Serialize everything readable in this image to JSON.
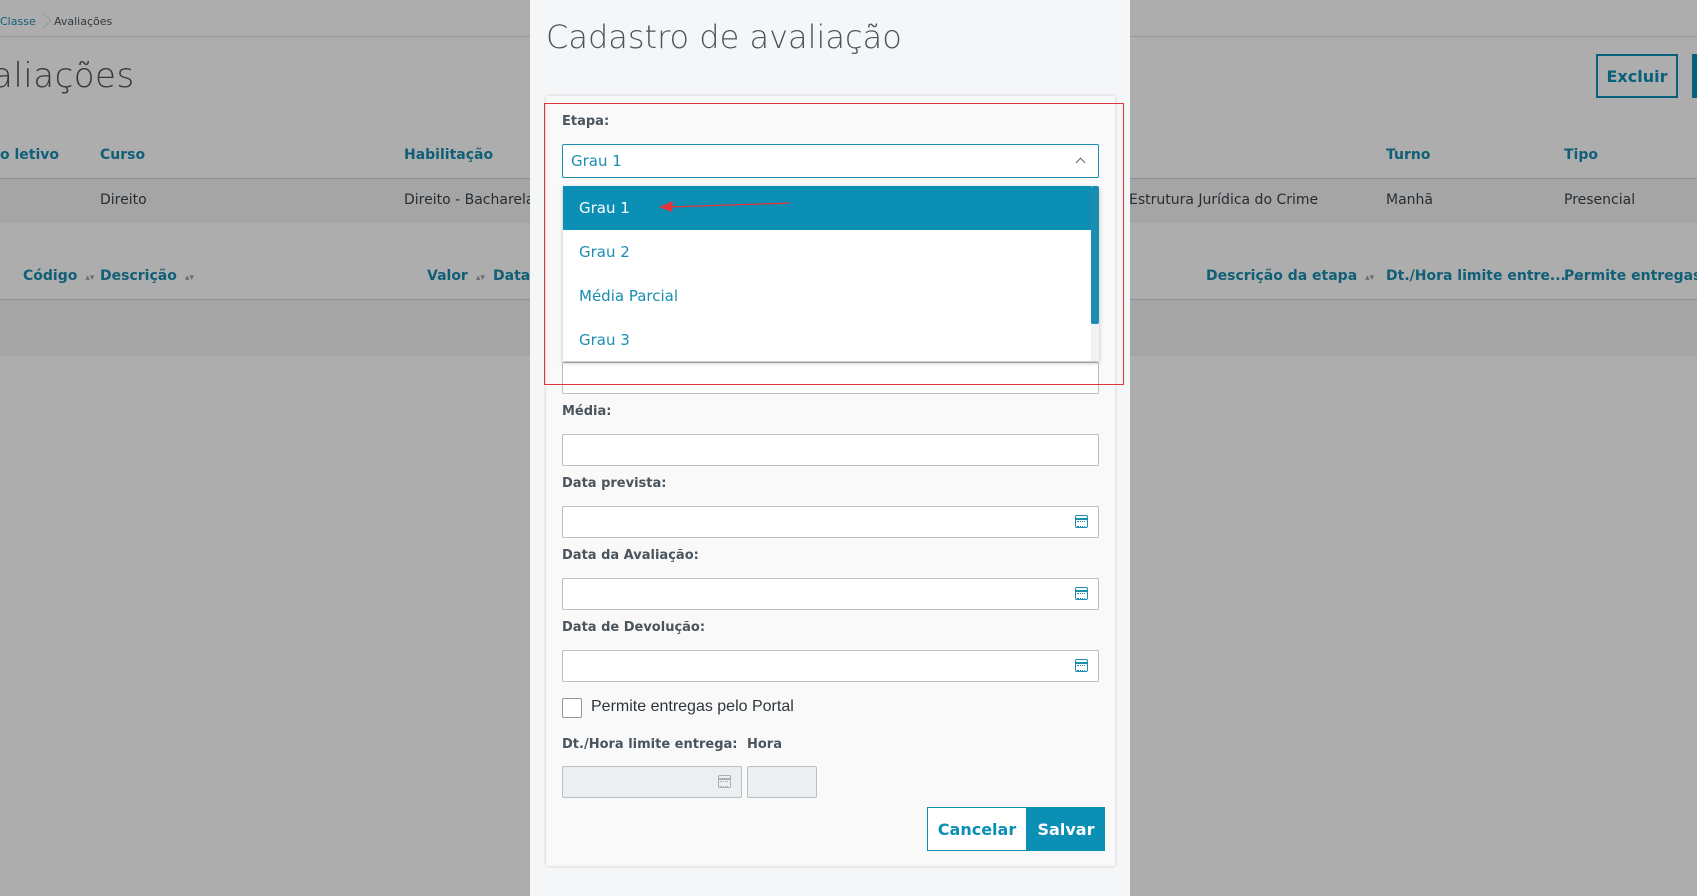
{
  "breadcrumb": {
    "link": "Classe",
    "current": "Avaliações"
  },
  "page": {
    "title": "aliações",
    "delete_label": "Excluir"
  },
  "table1": {
    "headers": [
      "o letivo",
      "Curso",
      "Habilitação",
      "Turno",
      "Tipo"
    ],
    "row": {
      "curso": "Direito",
      "habilitacao": "Direito - Bacharelado",
      "disciplina": "Estrutura Jurídica do Crime",
      "turno": "Manhã",
      "tipo": "Presencial"
    }
  },
  "table2": {
    "headers": [
      "Código",
      "Descrição",
      "Valor",
      "Data p",
      "Descrição da etapa",
      "Dt./Hora limite entre...",
      "Permite entregas pel"
    ]
  },
  "modal": {
    "title": "Cadastro de avaliação",
    "etapa_label": "Etapa:",
    "etapa_value": "Grau 1",
    "options": [
      "Grau 1",
      "Grau 2",
      "Média Parcial",
      "Grau 3"
    ],
    "selected_option": "Grau 1",
    "media_label": "Média:",
    "data_prevista_label": "Data prevista:",
    "data_avaliacao_label": "Data da Avaliação:",
    "data_devolucao_label": "Data de Devolução:",
    "permite_label": "Permite entregas pelo Portal",
    "dt_limite_label": "Dt./Hora limite entrega:",
    "hora_label": "Hora",
    "cancel_label": "Cancelar",
    "save_label": "Salvar"
  },
  "colors": {
    "accent": "#0c8fb5",
    "highlight": "#e0343a"
  }
}
